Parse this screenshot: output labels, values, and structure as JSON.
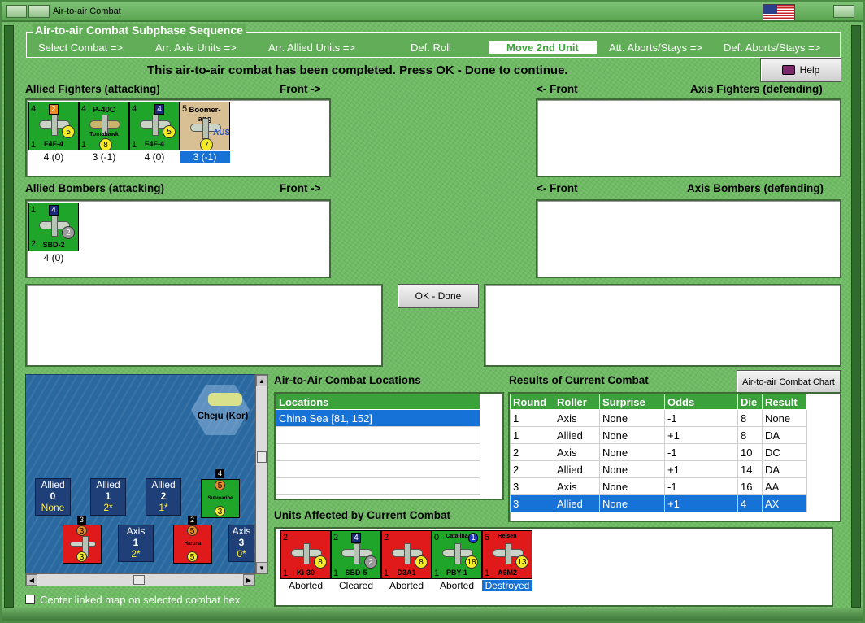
{
  "window": {
    "title": "Air-to-air Combat"
  },
  "sequence": {
    "title": "Air-to-air Combat Subphase Sequence",
    "steps": [
      "Select Combat =>",
      "Arr. Axis Units =>",
      "Arr. Allied Units =>",
      "Def. Roll",
      "Move 2nd Unit",
      "Att. Aborts/Stays =>",
      "Def. Aborts/Stays =>"
    ],
    "active_step": "Move 2nd Unit"
  },
  "status_message": "This air-to-air combat has been completed.  Press OK - Done to continue.",
  "buttons": {
    "help": "Help",
    "ok_done": "OK - Done",
    "chart": "Air-to-air Combat Chart"
  },
  "labels": {
    "allied_fighters": "Allied Fighters (attacking)",
    "front_right": "Front ->",
    "front_left": "<- Front",
    "axis_fighters": "Axis Fighters (defending)",
    "allied_bombers": "Allied Bombers (attacking)",
    "axis_bombers": "Axis Bombers (defending)",
    "locations_title": "Air-to-Air Combat Locations",
    "results_title": "Results of Current Combat",
    "units_affected_title": "Units Affected by Current Combat",
    "center_map": "Center linked map on selected combat hex"
  },
  "allied_fighters": [
    {
      "name": "F4F-4",
      "tl": "4",
      "bl": "1",
      "box": "2",
      "die": "5",
      "caption": "4 (0)"
    },
    {
      "name": "P-40C",
      "sub": "Tomahawk",
      "tl": "4",
      "bl": "1",
      "die": "8",
      "caption": "3 (-1)"
    },
    {
      "name": "F4F-4",
      "tl": "4",
      "bl": "1",
      "box": "4",
      "die": "5",
      "caption": "4 (0)"
    },
    {
      "name": "Boomer-ang",
      "nation": "AUS",
      "tl": "5",
      "die": "7",
      "caption": "3 (-1)"
    }
  ],
  "allied_bombers": [
    {
      "name": "SBD-2",
      "tl": "1",
      "bl": "2",
      "box": "4",
      "die": "2",
      "caption": "4 (0)"
    }
  ],
  "map": {
    "hex_name": "Cheju (Kor)",
    "boxes": [
      {
        "side": "Allied",
        "num": "0",
        "val": "None"
      },
      {
        "side": "Allied",
        "num": "1",
        "val": "2*"
      },
      {
        "side": "Allied",
        "num": "2",
        "val": "1*"
      },
      {
        "side": "Axis",
        "num": "1",
        "val": "2*"
      },
      {
        "side": "Axis",
        "num": "3",
        "val": "0*"
      }
    ],
    "stacks": [
      {
        "count": "4",
        "name": "Submarine",
        "a": "5",
        "b": "3"
      },
      {
        "count": "3",
        "a": "3",
        "b": "3"
      },
      {
        "count": "2",
        "name": "Haruna",
        "a": "5",
        "b": "5"
      }
    ]
  },
  "locations": {
    "header": "Locations",
    "rows": [
      "China Sea [81, 152]"
    ]
  },
  "results": {
    "columns": [
      "Round",
      "Roller",
      "Surprise",
      "Odds",
      "Die",
      "Result"
    ],
    "rows": [
      [
        "1",
        "Axis",
        "None",
        "-1",
        "8",
        "None"
      ],
      [
        "1",
        "Allied",
        "None",
        "+1",
        "8",
        "DA"
      ],
      [
        "2",
        "Axis",
        "None",
        "-1",
        "10",
        "DC"
      ],
      [
        "2",
        "Allied",
        "None",
        "+1",
        "14",
        "DA"
      ],
      [
        "3",
        "Axis",
        "None",
        "-1",
        "16",
        "AA"
      ],
      [
        "3",
        "Allied",
        "None",
        "+1",
        "4",
        "AX"
      ]
    ]
  },
  "units_affected": [
    {
      "name": "Ki-30",
      "color": "red",
      "tl": "2",
      "bl": "1",
      "die": "8",
      "caption": "Aborted"
    },
    {
      "name": "SBD-5",
      "color": "green",
      "tl": "2",
      "bl": "1",
      "box": "4",
      "die": "2",
      "caption": "Cleared"
    },
    {
      "name": "D3A1",
      "color": "red",
      "tl": "2",
      "bl": "1",
      "die": "8",
      "caption": "Aborted"
    },
    {
      "name": "PBY-1",
      "sub": "Catalina",
      "color": "green",
      "tl": "0",
      "bl": "1",
      "box": "1",
      "die": "18",
      "caption": "Aborted"
    },
    {
      "name": "A6M2",
      "sub": "Reisen",
      "color": "red",
      "tl": "5",
      "bl": "1",
      "die": "13",
      "caption": "Destroyed"
    }
  ]
}
